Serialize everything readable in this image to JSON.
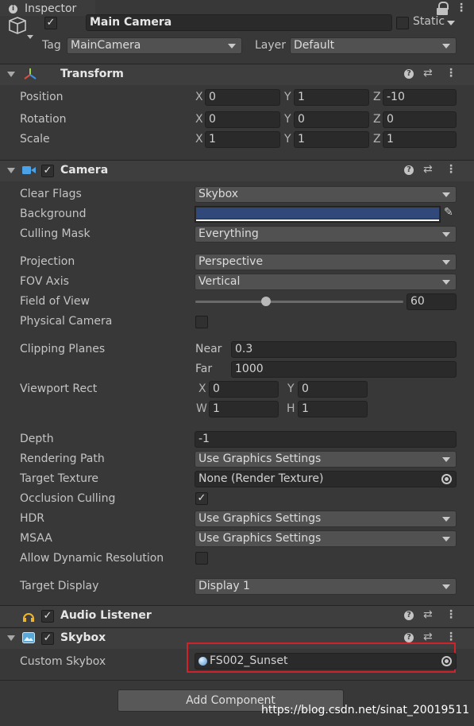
{
  "window": {
    "tab_title": "Inspector"
  },
  "gameobject": {
    "active": true,
    "name": "Main Camera",
    "static_label": "Static",
    "tag_label": "Tag",
    "tag_value": "MainCamera",
    "layer_label": "Layer",
    "layer_value": "Default"
  },
  "transform": {
    "title": "Transform",
    "position": {
      "label": "Position",
      "x": "0",
      "y": "1",
      "z": "-10"
    },
    "rotation": {
      "label": "Rotation",
      "x": "0",
      "y": "0",
      "z": "0"
    },
    "scale": {
      "label": "Scale",
      "x": "1",
      "y": "1",
      "z": "1"
    },
    "axis": {
      "x": "X",
      "y": "Y",
      "z": "Z"
    }
  },
  "camera": {
    "title": "Camera",
    "enabled": true,
    "clear_flags": {
      "label": "Clear Flags",
      "value": "Skybox"
    },
    "background": {
      "label": "Background",
      "color": "#31487a"
    },
    "culling_mask": {
      "label": "Culling Mask",
      "value": "Everything"
    },
    "projection": {
      "label": "Projection",
      "value": "Perspective"
    },
    "fov_axis": {
      "label": "FOV Axis",
      "value": "Vertical"
    },
    "field_of_view": {
      "label": "Field of View",
      "value": "60",
      "slider_fraction": 0.34
    },
    "physical_camera": {
      "label": "Physical Camera",
      "checked": false
    },
    "clipping_planes": {
      "label": "Clipping Planes",
      "near_label": "Near",
      "near": "0.3",
      "far_label": "Far",
      "far": "1000"
    },
    "viewport_rect": {
      "label": "Viewport Rect",
      "x_label": "X",
      "x": "0",
      "y_label": "Y",
      "y": "0",
      "w_label": "W",
      "w": "1",
      "h_label": "H",
      "h": "1"
    },
    "depth": {
      "label": "Depth",
      "value": "-1"
    },
    "rendering_path": {
      "label": "Rendering Path",
      "value": "Use Graphics Settings"
    },
    "target_texture": {
      "label": "Target Texture",
      "value": "None (Render Texture)"
    },
    "occlusion_culling": {
      "label": "Occlusion Culling",
      "checked": true
    },
    "hdr": {
      "label": "HDR",
      "value": "Use Graphics Settings"
    },
    "msaa": {
      "label": "MSAA",
      "value": "Use Graphics Settings"
    },
    "allow_dynamic_resolution": {
      "label": "Allow Dynamic Resolution",
      "checked": false
    },
    "target_display": {
      "label": "Target Display",
      "value": "Display 1"
    }
  },
  "audio_listener": {
    "title": "Audio Listener",
    "enabled": true
  },
  "skybox": {
    "title": "Skybox",
    "enabled": true,
    "custom_skybox": {
      "label": "Custom Skybox",
      "value": "FS002_Sunset"
    },
    "highlight_color": "#d0222b"
  },
  "footer": {
    "add_component": "Add Component",
    "watermark": "https://blog.csdn.net/sinat_20019511"
  },
  "icons": {
    "check": "✓",
    "help": "?",
    "presets": "⇄",
    "more": "⋮",
    "lock": "🔒",
    "info": "i",
    "eyedropper": "✎"
  }
}
